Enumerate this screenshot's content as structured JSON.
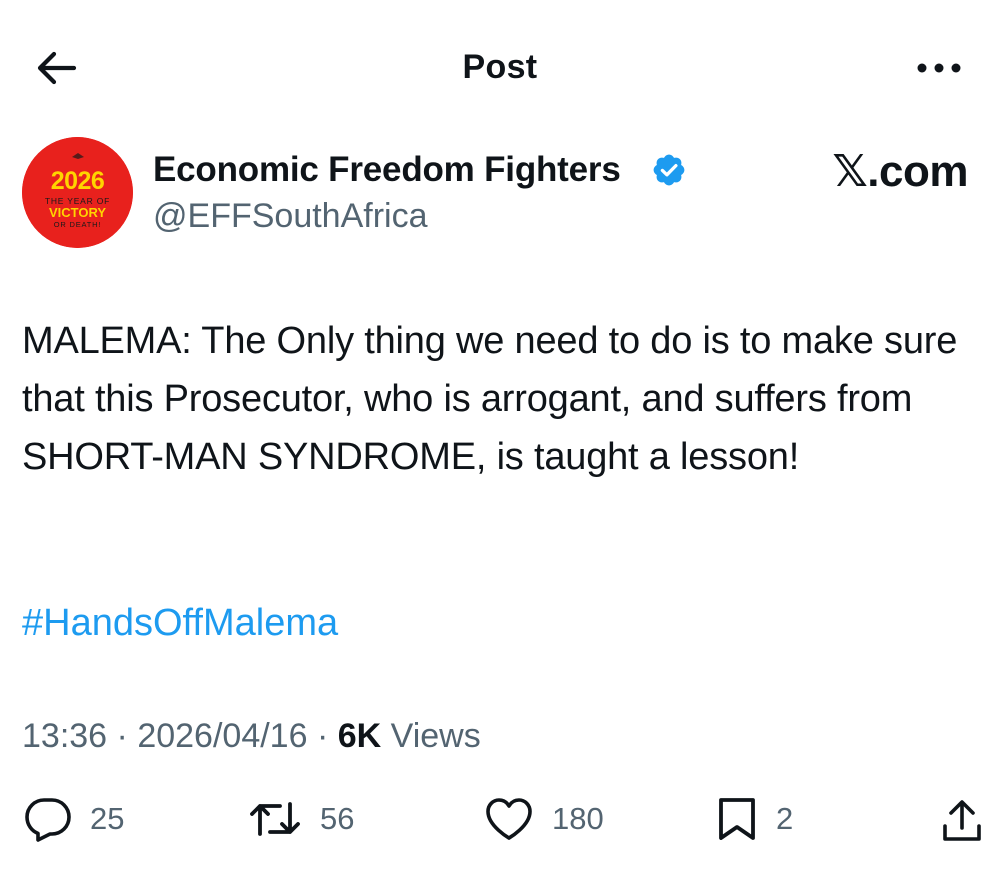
{
  "header": {
    "back_icon": "arrow-left-icon",
    "title": "Post",
    "more_icon": "more-horizontal-icon"
  },
  "author": {
    "name": "Economic Freedom Fighters",
    "handle": "@EFFSouthAfrica",
    "verified_icon": "verified-badge-icon",
    "avatar": {
      "year": "2026",
      "line1": "THE YEAR OF",
      "line2": "VICTORY",
      "line3": "OR DEATH!",
      "background": "#e8211d"
    }
  },
  "brand_watermark": "𝕏.com",
  "post": {
    "text": "MALEMA: The Only thing we need to do is to make sure that this Prosecutor, who is arrogant, and suffers from SHORT-MAN SYNDROME, is taught a lesson!",
    "hashtag": "#HandsOffMalema"
  },
  "meta": {
    "time": "13:36",
    "date": "2026/04/16",
    "views_count": "6K",
    "views_label": "Views"
  },
  "actions": {
    "reply": {
      "icon": "reply-icon",
      "count": "25"
    },
    "retweet": {
      "icon": "retweet-icon",
      "count": "56"
    },
    "like": {
      "icon": "heart-icon",
      "count": "180"
    },
    "bookmark": {
      "icon": "bookmark-icon",
      "count": "2"
    },
    "share": {
      "icon": "share-icon"
    }
  },
  "colors": {
    "text": "#0f1419",
    "secondary": "#536471",
    "link": "#1d9bf0",
    "verified": "#1d9bf0"
  }
}
